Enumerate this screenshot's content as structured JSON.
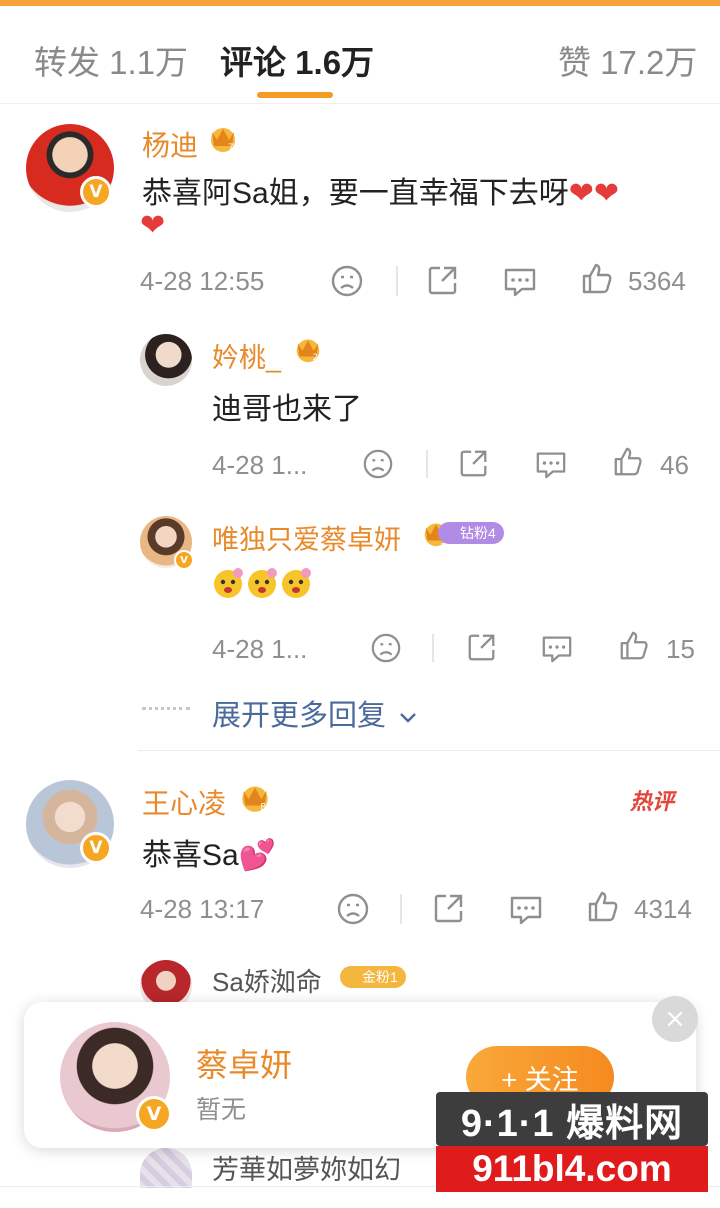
{
  "tabs": {
    "repost": "转发 1.1万",
    "comment": "评论 1.6万",
    "like": "赞 17.2万"
  },
  "comments": [
    {
      "user": "杨迪",
      "text": "恭喜阿Sa姐，要一直幸福下去呀",
      "text_hearts": "❤❤",
      "text_line2": "❤",
      "time": "4-28 12:55",
      "likes": "5364",
      "replies": [
        {
          "user": "妗桃_",
          "text": "迪哥也来了",
          "time": "4-28 1...",
          "likes": "46"
        },
        {
          "user": "唯独只爱蔡卓妍",
          "badge": "钻粉4",
          "text": "",
          "time": "4-28 1...",
          "likes": "15"
        }
      ],
      "expand_label": "展开更多回复"
    },
    {
      "user": "王心凌",
      "hot_tag": "热评",
      "text": "恭喜Sa",
      "text_emoji": "💕",
      "time": "4-28 13:17",
      "likes": "4314",
      "replies": [
        {
          "user": "Sa娇洳命",
          "badge": "金粉1"
        },
        {
          "user": "芳華如夢妳如幻"
        }
      ]
    }
  ],
  "follow_card": {
    "name": "蔡卓妍",
    "bio": "暂无",
    "follow_label": "+ 关注",
    "close": "×"
  },
  "watermark": {
    "top": "9·1·1 爆料网",
    "bottom": "911bl4.com"
  },
  "colors": {
    "accent": "#f59a23",
    "username": "#e8892a",
    "link": "#4b6a9a",
    "heart": "#e53b3b"
  }
}
